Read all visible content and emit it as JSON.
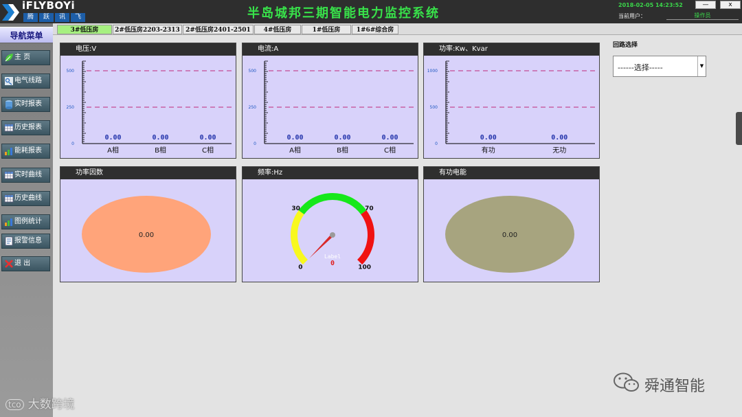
{
  "header": {
    "logo_text": "iFLYBOYi",
    "logo_sub": [
      "腾",
      "跃",
      "讯",
      "飞"
    ],
    "app_title": "半岛城邦三期智能电力监控系统",
    "datetime": "2018-02-05 14:23:52",
    "user_label": "当前用户：",
    "user_value": "操作员",
    "minimize_label": "—",
    "close_label": "x"
  },
  "sidebar": {
    "title": "导航菜单",
    "items": [
      {
        "label": "主 页",
        "icon": "leaf-icon"
      },
      {
        "label": "电气线路",
        "icon": "circuit-icon"
      },
      {
        "label": "实时报表",
        "icon": "database-icon"
      },
      {
        "label": "历史报表",
        "icon": "table-icon"
      },
      {
        "label": "能耗报表",
        "icon": "bar-chart-icon"
      },
      {
        "label": "实时曲线",
        "icon": "table-icon"
      },
      {
        "label": "历史曲线",
        "icon": "table-icon"
      },
      {
        "label": "图例统计",
        "icon": "bar-chart-icon"
      },
      {
        "label": "报警信息",
        "icon": "document-icon"
      },
      {
        "label": "退 出",
        "icon": "close-icon"
      }
    ]
  },
  "tabs": [
    {
      "label": "3#低压房",
      "active": true
    },
    {
      "label": "2#低压房2203-2313",
      "active": false
    },
    {
      "label": "2#低压房2401-2501",
      "active": false
    },
    {
      "label": "4#低压房",
      "active": false
    },
    {
      "label": "1#低压房",
      "active": false
    },
    {
      "label": "1#6#综合房",
      "active": false
    }
  ],
  "panels": {
    "voltage": {
      "title": "电压:V"
    },
    "current": {
      "title": "电流:A"
    },
    "power": {
      "title": "功率:Kw、Kvar"
    },
    "power_factor": {
      "title": "功率因数",
      "value": "0.00",
      "color": "#ffa47a"
    },
    "frequency": {
      "title": "频率:Hz"
    },
    "active_energy": {
      "title": "有功电能",
      "value": "0.00",
      "color": "#a7a47f"
    }
  },
  "chart_data": [
    {
      "type": "bar",
      "title": "电压:V",
      "categories": [
        "A相",
        "B相",
        "C相"
      ],
      "values": [
        0,
        0,
        0
      ],
      "value_labels": [
        "0.00",
        "0.00",
        "0.00"
      ],
      "ylim": [
        0,
        500
      ],
      "y_ticks": [
        "0",
        "250",
        "500"
      ],
      "reference_lines": [
        250,
        500
      ]
    },
    {
      "type": "bar",
      "title": "电流:A",
      "categories": [
        "A相",
        "B相",
        "C相"
      ],
      "values": [
        0,
        0,
        0
      ],
      "value_labels": [
        "0.00",
        "0.00",
        "0.00"
      ],
      "ylim": [
        0,
        500
      ],
      "y_ticks": [
        "0",
        "250",
        "500"
      ],
      "reference_lines": [
        250,
        500
      ]
    },
    {
      "type": "bar",
      "title": "功率:Kw、Kvar",
      "categories": [
        "有功",
        "无功"
      ],
      "values": [
        0,
        0
      ],
      "value_labels": [
        "0.00",
        "0.00"
      ],
      "ylim": [
        0,
        1000
      ],
      "y_ticks": [
        "0",
        "500",
        "1000"
      ],
      "reference_lines": [
        500,
        1000
      ]
    },
    {
      "type": "gauge",
      "title": "频率:Hz",
      "value": 0,
      "value_label": "0",
      "range": [
        0,
        100
      ],
      "tick_labels": [
        "0",
        "30",
        "70",
        "100"
      ],
      "center_label": "Label",
      "bands": [
        {
          "from": 0,
          "to": 30,
          "color": "#f8f81e"
        },
        {
          "from": 30,
          "to": 70,
          "color": "#16e81a"
        },
        {
          "from": 70,
          "to": 100,
          "color": "#f01212"
        }
      ]
    }
  ],
  "side": {
    "circuit_label": "回路选择",
    "select_value": "------选择-----"
  },
  "watermark": {
    "right_text": "舜通智能",
    "left_symbol": "tco",
    "left_text": "大数跨境"
  },
  "colors": {
    "panel_bg": "#d8d2fa",
    "panel_header": "#2f2f2f",
    "title_green": "#38e24a",
    "reference_line": "#c0287a",
    "value_text": "#2233aa",
    "active_tab": "#a6f080"
  }
}
